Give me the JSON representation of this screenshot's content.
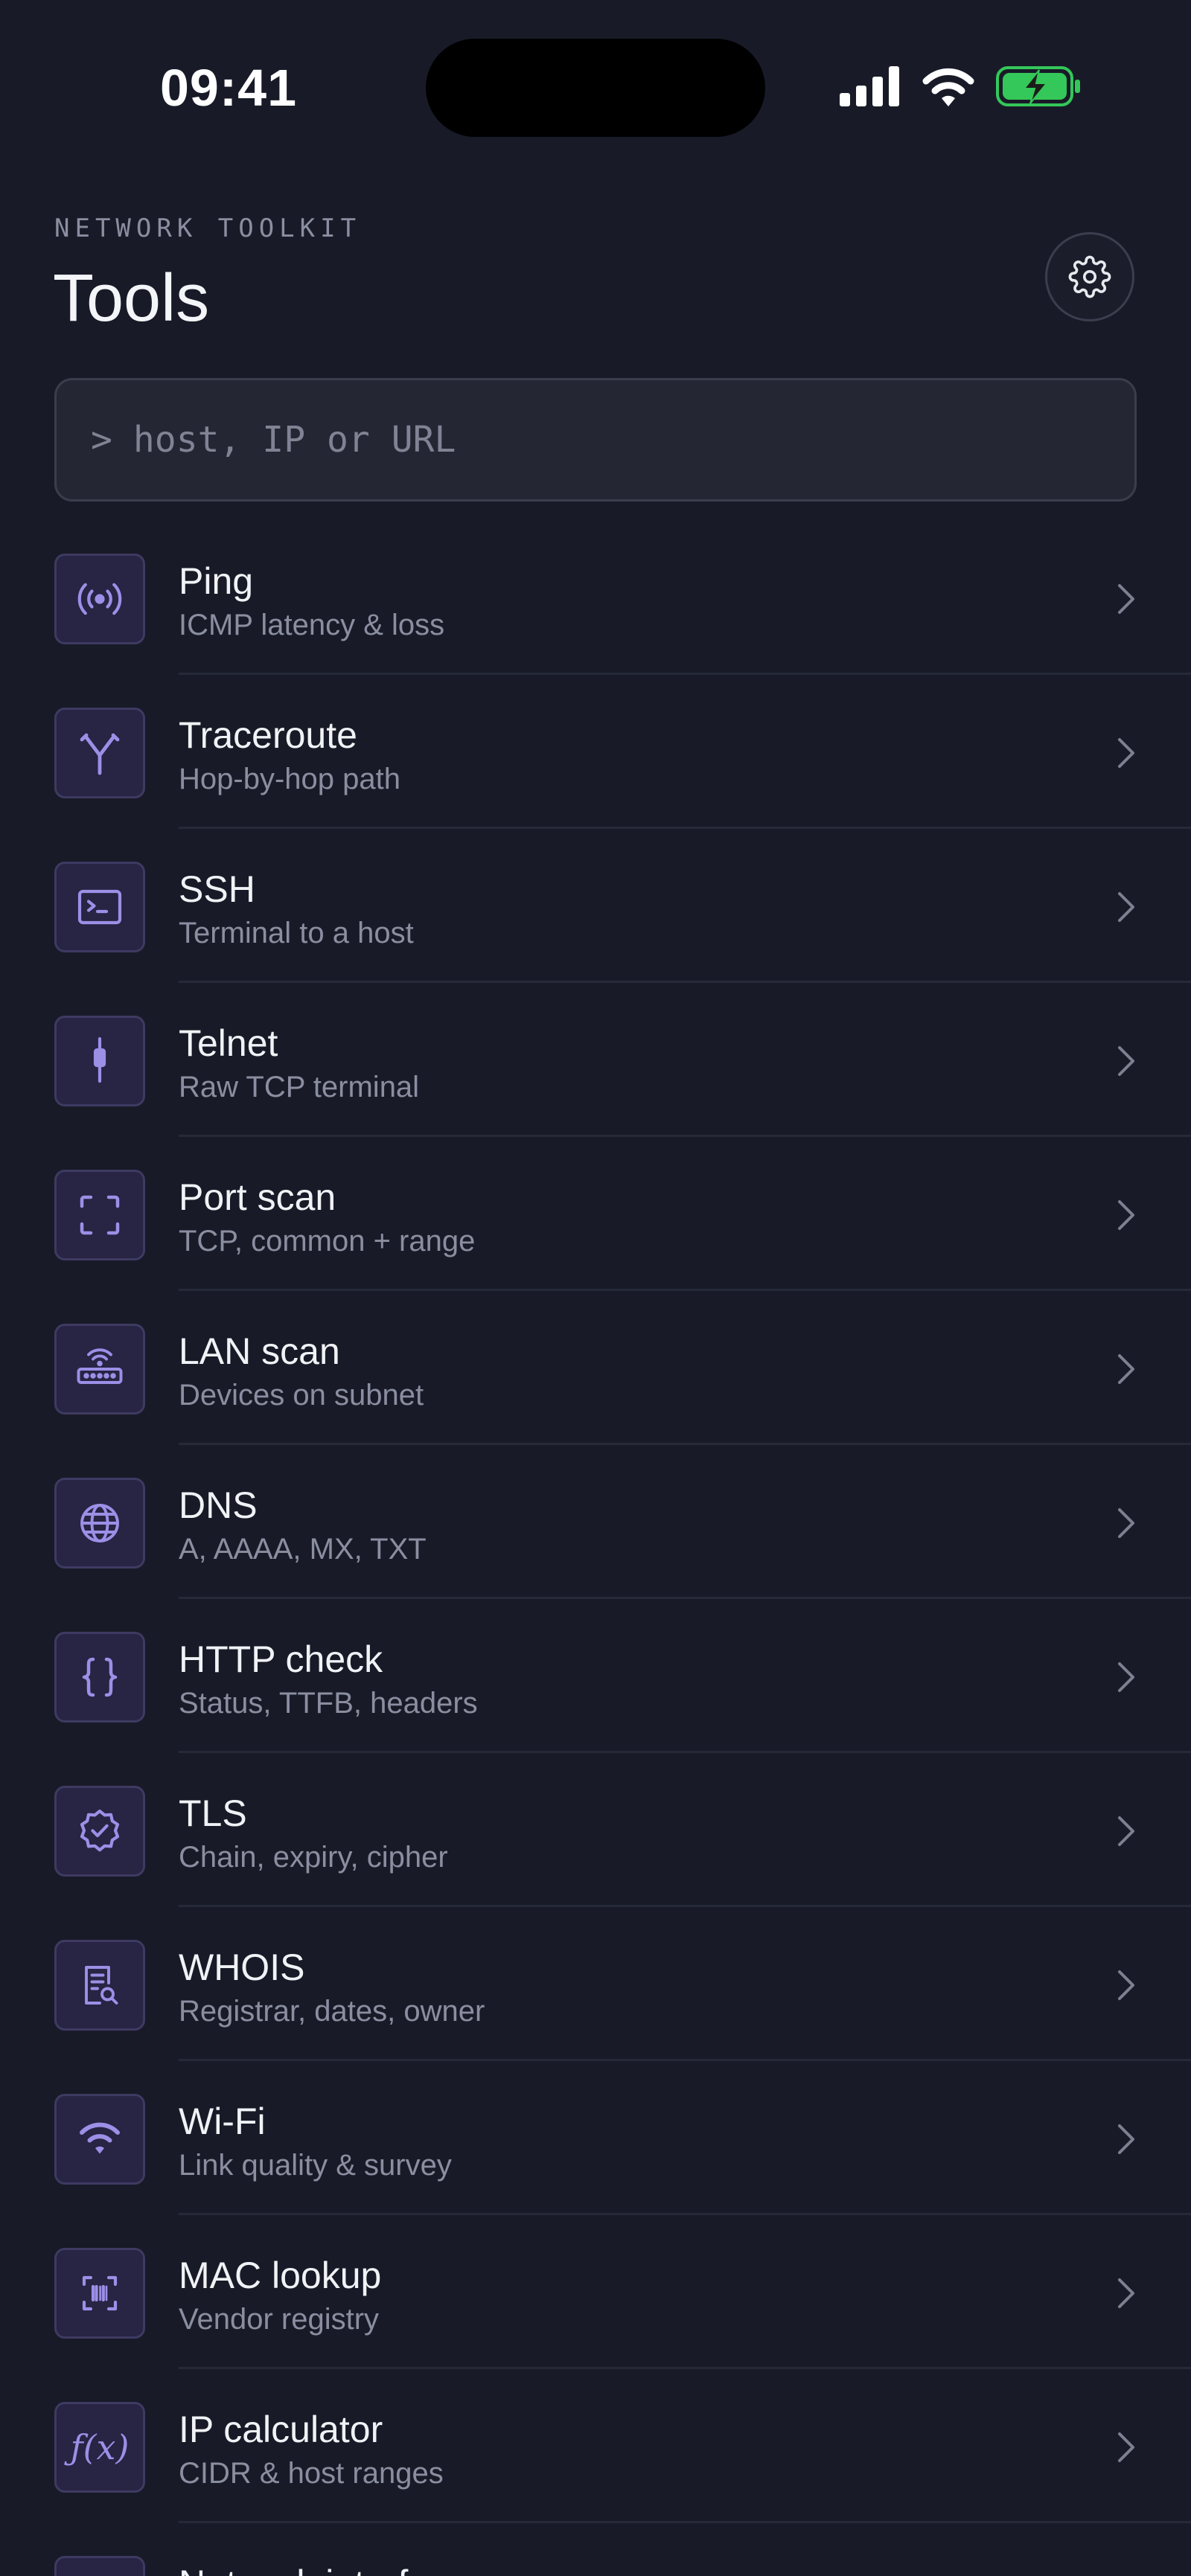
{
  "status_bar": {
    "time": "09:41"
  },
  "header": {
    "eyebrow": "NETWORK TOOLKIT",
    "title": "Tools"
  },
  "search": {
    "prompt": ">",
    "placeholder": "host, IP or URL",
    "value": ""
  },
  "accent_color": "#9b8fe6",
  "tools": [
    {
      "name": "Ping",
      "desc": "ICMP latency & loss",
      "icon": "broadcast-icon"
    },
    {
      "name": "Traceroute",
      "desc": "Hop-by-hop path",
      "icon": "route-split-icon"
    },
    {
      "name": "SSH",
      "desc": "Terminal to a host",
      "icon": "terminal-icon"
    },
    {
      "name": "Telnet",
      "desc": "Raw TCP terminal",
      "icon": "plug-icon"
    },
    {
      "name": "Port scan",
      "desc": "TCP, common + range",
      "icon": "scan-frame-icon"
    },
    {
      "name": "LAN scan",
      "desc": "Devices on subnet",
      "icon": "router-icon"
    },
    {
      "name": "DNS",
      "desc": "A, AAAA, MX, TXT",
      "icon": "globe-icon"
    },
    {
      "name": "HTTP check",
      "desc": "Status, TTFB, headers",
      "icon": "braces-icon"
    },
    {
      "name": "TLS",
      "desc": "Chain, expiry, cipher",
      "icon": "verified-badge-icon"
    },
    {
      "name": "WHOIS",
      "desc": "Registrar, dates, owner",
      "icon": "document-search-icon"
    },
    {
      "name": "Wi-Fi",
      "desc": "Link quality & survey",
      "icon": "wifi-icon"
    },
    {
      "name": "MAC lookup",
      "desc": "Vendor registry",
      "icon": "barcode-scan-icon"
    },
    {
      "name": "IP calculator",
      "desc": "CIDR & host ranges",
      "icon": "function-icon"
    },
    {
      "name": "Network interfaces",
      "desc": "",
      "icon": "network-interface-icon"
    }
  ]
}
